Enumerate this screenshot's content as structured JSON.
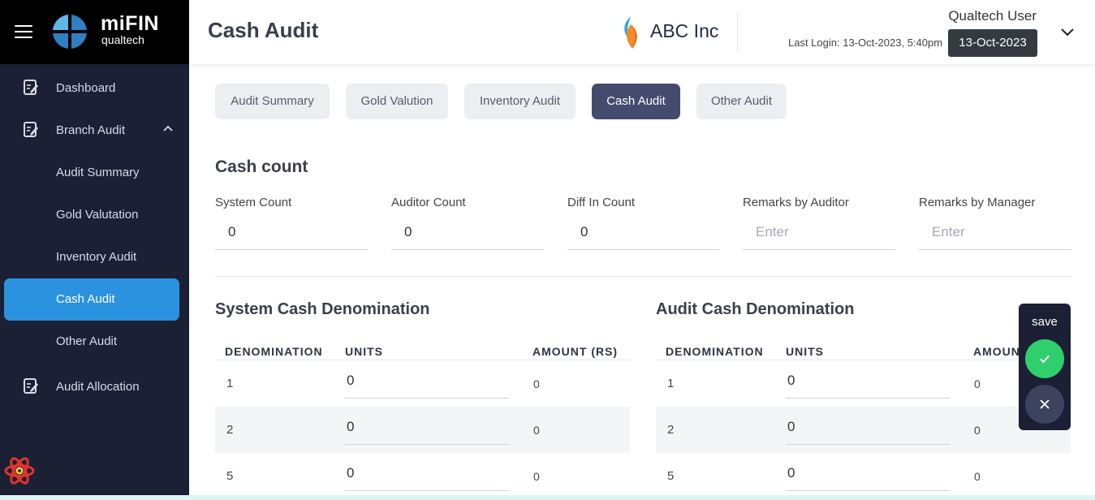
{
  "brand": {
    "name": "miFIN",
    "sub": "qualtech"
  },
  "sidebar": {
    "items": [
      {
        "label": "Dashboard",
        "icon": "document-edit-icon"
      },
      {
        "label": "Branch Audit",
        "icon": "document-edit-icon"
      },
      {
        "label": "Audit Summary"
      },
      {
        "label": "Gold Valutation"
      },
      {
        "label": "Inventory Audit"
      },
      {
        "label": "Cash Audit",
        "active": true
      },
      {
        "label": "Other Audit"
      },
      {
        "label": "Audit Allocation",
        "icon": "document-edit-icon"
      }
    ]
  },
  "header": {
    "title": "Cash Audit",
    "org_name": "ABC Inc",
    "user_name": "Qualtech User",
    "last_login": "Last Login: 13-Oct-2023, 5:40pm",
    "date": "13-Oct-2023"
  },
  "tabs": [
    {
      "label": "Audit Summary"
    },
    {
      "label": "Gold Valution"
    },
    {
      "label": "Inventory Audit"
    },
    {
      "label": "Cash Audit",
      "active": true
    },
    {
      "label": "Other Audit"
    }
  ],
  "cash_count": {
    "title": "Cash count",
    "system_count": {
      "label": "System Count",
      "value": "0"
    },
    "auditor_count": {
      "label": "Auditor Count",
      "value": "0"
    },
    "diff_count": {
      "label": "Diff In Count",
      "value": "0"
    },
    "remarks_auditor": {
      "label": "Remarks by Auditor",
      "placeholder": "Enter"
    },
    "remarks_manager": {
      "label": "Remarks by Manager",
      "placeholder": "Enter"
    }
  },
  "system_denomination": {
    "title": "System Cash Denomination",
    "headers": {
      "denomination": "DENOMINATION",
      "units": "UNITS",
      "amount": "AMOUNT (RS)"
    },
    "rows": [
      {
        "denomination": "1",
        "units": "0",
        "amount": "0"
      },
      {
        "denomination": "2",
        "units": "0",
        "amount": "0"
      },
      {
        "denomination": "5",
        "units": "0",
        "amount": "0"
      }
    ]
  },
  "audit_denomination": {
    "title": "Audit Cash Denomination",
    "headers": {
      "denomination": "DENOMINATION",
      "units": "UNITS",
      "amount": "AMOUN"
    },
    "rows": [
      {
        "denomination": "1",
        "units": "0",
        "amount": "0"
      },
      {
        "denomination": "2",
        "units": "0",
        "amount": "0"
      },
      {
        "denomination": "5",
        "units": "0",
        "amount": "0"
      }
    ]
  },
  "save_panel": {
    "label": "save"
  },
  "colors": {
    "sidebar_bg": "#1b2035",
    "active_nav": "#2b92e0",
    "active_tab": "#444b6e",
    "confirm": "#2fcf6e",
    "date_badge": "#343a40"
  }
}
